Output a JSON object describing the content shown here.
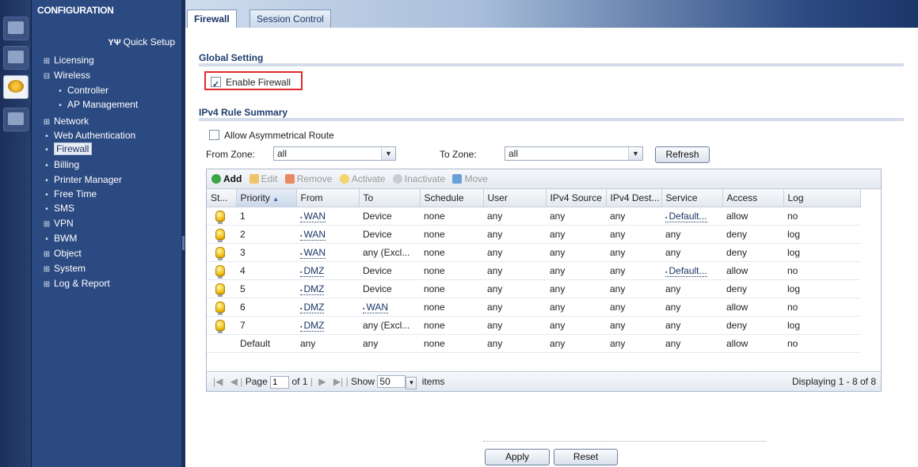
{
  "nav": {
    "title": "CONFIGURATION",
    "quick_setup": "Quick Setup",
    "items": [
      {
        "marker": "⊞",
        "label": "Licensing"
      },
      {
        "marker": "⊟",
        "label": "Wireless"
      },
      {
        "marker": "•",
        "label": "Controller"
      },
      {
        "marker": "•",
        "label": "AP Management"
      },
      {
        "marker": "⊞",
        "label": "Network"
      },
      {
        "marker": "•",
        "label": "Web Authentication"
      },
      {
        "marker": "•",
        "label": "Firewall"
      },
      {
        "marker": "•",
        "label": "Billing"
      },
      {
        "marker": "•",
        "label": "Printer Manager"
      },
      {
        "marker": "•",
        "label": "Free Time"
      },
      {
        "marker": "•",
        "label": "SMS"
      },
      {
        "marker": "⊞",
        "label": "VPN"
      },
      {
        "marker": "•",
        "label": "BWM"
      },
      {
        "marker": "⊞",
        "label": "Object"
      },
      {
        "marker": "⊞",
        "label": "System"
      },
      {
        "marker": "⊞",
        "label": "Log & Report"
      }
    ]
  },
  "tabs": [
    {
      "label": "Firewall",
      "active": true
    },
    {
      "label": "Session Control",
      "active": false
    }
  ],
  "global_setting": {
    "title": "Global Setting",
    "enable_firewall_label": "Enable Firewall",
    "enable_firewall_checked": true
  },
  "rule_summary": {
    "title": "IPv4 Rule Summary",
    "asym_label": "Allow Asymmetrical Route",
    "asym_checked": false,
    "from_zone_label": "From Zone:",
    "from_zone_value": "all",
    "to_zone_label": "To Zone:",
    "to_zone_value": "all",
    "refresh_label": "Refresh"
  },
  "toolbar": {
    "add": "Add",
    "edit": "Edit",
    "remove": "Remove",
    "activate": "Activate",
    "inactivate": "Inactivate",
    "move": "Move"
  },
  "table": {
    "columns": [
      "St...",
      "Priority",
      "From",
      "To",
      "Schedule",
      "User",
      "IPv4 Source",
      "IPv4 Dest...",
      "Service",
      "Access",
      "Log"
    ],
    "sort_indicator": "▲",
    "rows": [
      {
        "priority": "1",
        "from": "WAN",
        "to": "Device",
        "schedule": "none",
        "user": "any",
        "src": "any",
        "dst": "any",
        "service": "Default...",
        "access": "allow",
        "log": "no"
      },
      {
        "priority": "2",
        "from": "WAN",
        "to": "Device",
        "schedule": "none",
        "user": "any",
        "src": "any",
        "dst": "any",
        "service": "any",
        "access": "deny",
        "log": "log"
      },
      {
        "priority": "3",
        "from": "WAN",
        "to": "any (Excl...",
        "schedule": "none",
        "user": "any",
        "src": "any",
        "dst": "any",
        "service": "any",
        "access": "deny",
        "log": "log"
      },
      {
        "priority": "4",
        "from": "DMZ",
        "to": "Device",
        "schedule": "none",
        "user": "any",
        "src": "any",
        "dst": "any",
        "service": "Default...",
        "access": "allow",
        "log": "no"
      },
      {
        "priority": "5",
        "from": "DMZ",
        "to": "Device",
        "schedule": "none",
        "user": "any",
        "src": "any",
        "dst": "any",
        "service": "any",
        "access": "deny",
        "log": "log"
      },
      {
        "priority": "6",
        "from": "DMZ",
        "to": "WAN",
        "schedule": "none",
        "user": "any",
        "src": "any",
        "dst": "any",
        "service": "any",
        "access": "allow",
        "log": "no"
      },
      {
        "priority": "7",
        "from": "DMZ",
        "to": "any (Excl...",
        "schedule": "none",
        "user": "any",
        "src": "any",
        "dst": "any",
        "service": "any",
        "access": "deny",
        "log": "log"
      },
      {
        "priority": "Default",
        "from": "any",
        "to": "any",
        "schedule": "none",
        "user": "any",
        "src": "any",
        "dst": "any",
        "service": "any",
        "access": "allow",
        "log": "no"
      }
    ]
  },
  "pager": {
    "page_label": "Page",
    "page_value": "1",
    "of_label": "of 1",
    "show_label": "Show",
    "show_value": "50",
    "items_label": "items",
    "displaying": "Displaying 1 - 8 of 8"
  },
  "footer": {
    "apply_label": "Apply",
    "reset_label": "Reset"
  },
  "colors": {
    "nav_bg": "#2c4a82",
    "highlight_border": "#e32b2b",
    "section_title": "#1e3d6e"
  }
}
